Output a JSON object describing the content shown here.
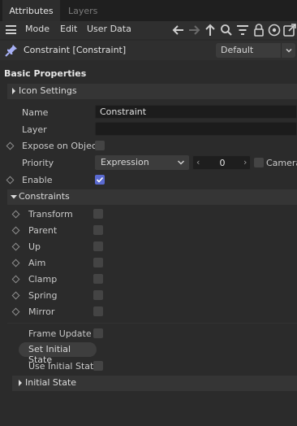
{
  "tabs": {
    "attributes": "Attributes",
    "layers": "Layers"
  },
  "menu": {
    "mode": "Mode",
    "edit": "Edit",
    "user_data": "User Data"
  },
  "toolbar_icons": [
    "arrow-left-icon",
    "arrow-right-icon",
    "arrow-up-icon",
    "search-icon",
    "filter-icon",
    "lock-icon",
    "target-icon",
    "new-window-icon"
  ],
  "object": {
    "title": "Constraint [Constraint]",
    "mode_value": "Default"
  },
  "section_title": "Basic Properties",
  "groups": {
    "icon_settings": "Icon Settings",
    "constraints": "Constraints",
    "initial_state": "Initial State"
  },
  "basic": {
    "name_label": "Name",
    "name_value": "Constraint",
    "layer_label": "Layer",
    "layer_value": "",
    "expose_label": "Expose on Object",
    "priority_label": "Priority",
    "priority_value": "Expression",
    "priority_number": "0",
    "camera_label": "Camera",
    "enable_label": "Enable"
  },
  "constraints": [
    {
      "label": "Transform",
      "checked": false
    },
    {
      "label": "Parent",
      "checked": false
    },
    {
      "label": "Up",
      "checked": false
    },
    {
      "label": "Aim",
      "checked": false
    },
    {
      "label": "Clamp",
      "checked": false
    },
    {
      "label": "Spring",
      "checked": false
    },
    {
      "label": "Mirror",
      "checked": false
    }
  ],
  "state": {
    "frame_update_label": "Frame Update",
    "set_initial_button": "Set Initial State",
    "use_initial_label": "Use Initial State"
  },
  "colors": {
    "accent": "#5a6ad0",
    "panel_bg": "#2b2b2b",
    "field_bg": "#1c1c1c"
  }
}
